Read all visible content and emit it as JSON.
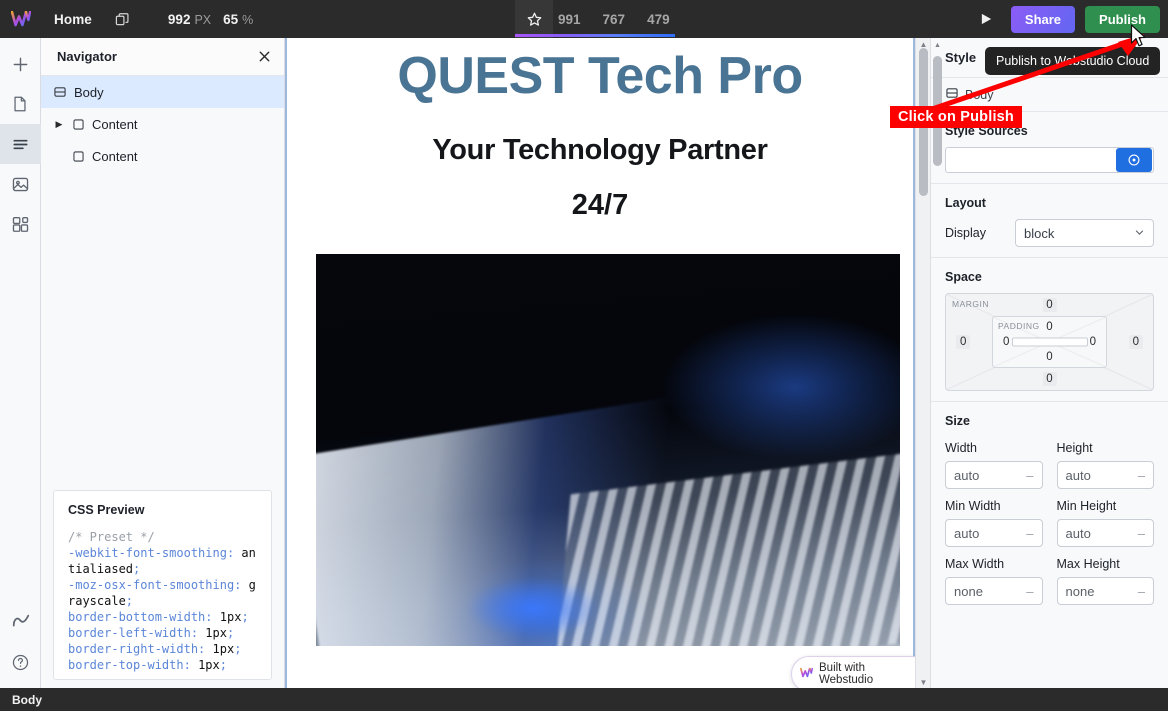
{
  "topbar": {
    "logo_icon": "webstudio-logo-icon",
    "home_label": "Home",
    "duplicate_icon": "duplicate-icon",
    "width_value": "992",
    "width_unit": "PX",
    "zoom_value": "65",
    "zoom_unit": "%",
    "star_icon": "star-icon",
    "breakpoints": [
      "991",
      "767",
      "479"
    ],
    "play_icon": "play-icon",
    "share_label": "Share",
    "publish_label": "Publish"
  },
  "rail": {
    "items": [
      {
        "icon": "plus-icon",
        "name": "add-element"
      },
      {
        "icon": "page-icon",
        "name": "pages"
      },
      {
        "icon": "navigator-icon",
        "name": "navigator"
      },
      {
        "icon": "image-icon",
        "name": "assets"
      },
      {
        "icon": "components-icon",
        "name": "components"
      }
    ],
    "bottom_items": [
      {
        "icon": "marketplace-icon",
        "name": "marketplace"
      },
      {
        "icon": "help-icon",
        "name": "help"
      }
    ]
  },
  "navigator": {
    "title": "Navigator",
    "close_icon": "close-icon",
    "tree": [
      {
        "label": "Body",
        "icon": "body-icon",
        "selected": true,
        "depth": 0,
        "expandable": false
      },
      {
        "label": "Content",
        "icon": "box-icon",
        "selected": false,
        "depth": 1,
        "expandable": true
      },
      {
        "label": "Content",
        "icon": "box-icon",
        "selected": false,
        "depth": 1,
        "expandable": false
      }
    ]
  },
  "css_preview": {
    "title": "CSS Preview",
    "lines": [
      {
        "comment": "/* Preset */"
      },
      {
        "prop": "-webkit-font-smoothing",
        "value": "antialiased"
      },
      {
        "prop": "-moz-osx-font-smoothing",
        "value": "grayscale"
      },
      {
        "prop": "border-bottom-width",
        "value": "1px"
      },
      {
        "prop": "border-left-width",
        "value": "1px"
      },
      {
        "prop": "border-right-width",
        "value": "1px"
      },
      {
        "prop": "border-top-width",
        "value": "1px"
      }
    ]
  },
  "canvas": {
    "heading": "QUEST Tech Pro",
    "subheading": "Your Technology Partner",
    "tagline": "24/7",
    "hero_image_alt": "robotic-hand-on-keyboard-image",
    "badge_label": "Built with Webstudio",
    "badge_icon": "webstudio-logo-icon"
  },
  "style_panel": {
    "tab_label": "Style",
    "breadcrumb": "Body",
    "breadcrumb_icon": "body-icon",
    "style_sources": {
      "label": "Style Sources",
      "input_value": "",
      "add_icon": "target-icon"
    },
    "layout": {
      "label": "Layout",
      "display_label": "Display",
      "display_value": "block",
      "chevron_icon": "chevron-down-icon"
    },
    "space": {
      "label": "Space",
      "margin_tag": "MARGIN",
      "padding_tag": "PADDING",
      "margin": {
        "top": "0",
        "right": "0",
        "bottom": "0",
        "left": "0"
      },
      "padding": {
        "top": "0",
        "right": "0",
        "bottom": "0",
        "left": "0"
      }
    },
    "size": {
      "label": "Size",
      "fields": [
        {
          "label": "Width",
          "value": "auto"
        },
        {
          "label": "Height",
          "value": "auto"
        },
        {
          "label": "Min Width",
          "value": "auto"
        },
        {
          "label": "Min Height",
          "value": "auto"
        },
        {
          "label": "Max Width",
          "value": "none"
        },
        {
          "label": "Max Height",
          "value": "none"
        }
      ]
    }
  },
  "statusbar": {
    "label": "Body"
  },
  "annotations": {
    "tooltip": "Publish to Webstudio Cloud",
    "callout": "Click on Publish",
    "arrow_color": "#ff0000",
    "callout_bg": "#ff0000"
  },
  "colors": {
    "publish_green": "#2f8f4e",
    "share_purple": "#8b5cf6",
    "accent_blue": "#1f6fe0",
    "selected_row": "#dbeafe",
    "topbar_bg": "#2b2b2b",
    "heading_blue": "#4a7493"
  }
}
